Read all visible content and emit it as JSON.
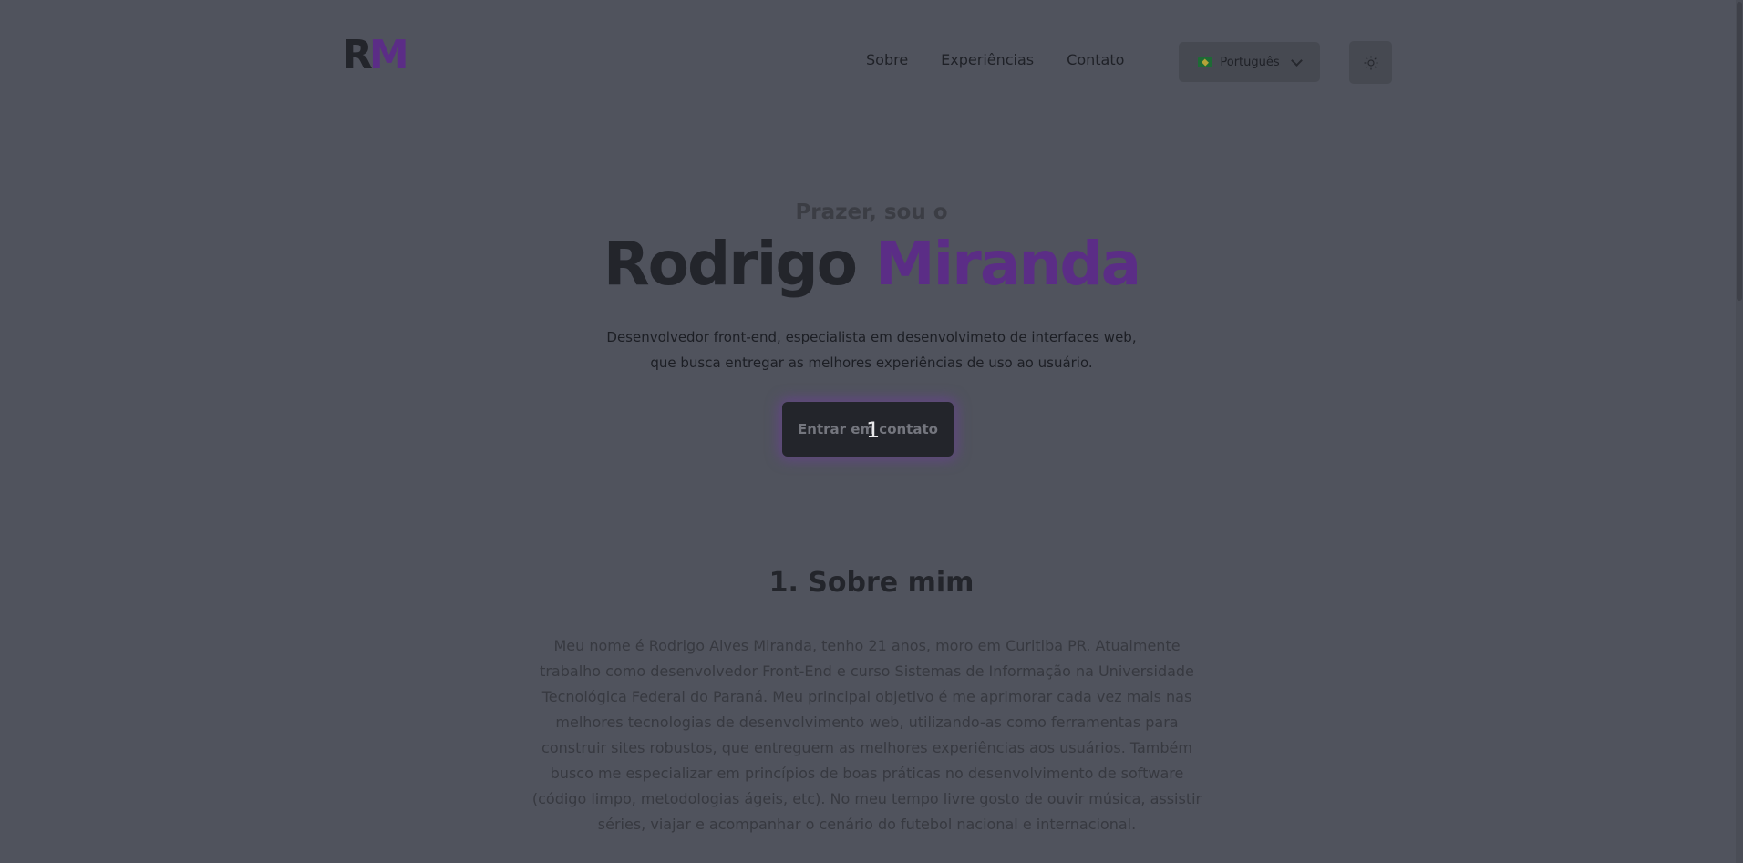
{
  "header": {
    "logo": {
      "r": "R",
      "m": "M"
    },
    "nav": [
      "Sobre",
      "Experiências",
      "Contato"
    ],
    "language": {
      "label": "Português",
      "flag": "brazil-flag-icon"
    },
    "theme_toggle": "sun-icon"
  },
  "hero": {
    "greeting": "Prazer, sou o",
    "first_name": "Rodrigo",
    "last_name": "Miranda",
    "tagline_line1": "Desenvolvedor front-end, especialista em desenvolvimeto de interfaces web,",
    "tagline_line2": "que busca entregar as melhores experiências de uso ao usuário.",
    "cta_label": "Entrar em contato",
    "badge": "1"
  },
  "about": {
    "title": "1. Sobre mim",
    "lines": [
      "Meu nome é Rodrigo Alves Miranda, tenho 21 anos, moro em Curitiba PR. Atualmente",
      "trabalho como desenvolvedor Front-End e curso Sistemas de Informação na Universidade",
      "Tecnológica Federal do Paraná. Meu principal objetivo é me aprimorar cada vez mais nas",
      "melhores tecnologias de desenvolvimento web, utilizando-as como ferramentas para",
      "construir sites robustos, que entreguem as melhores experiências aos usuários. Também",
      "busco me especializar em princípios de boas práticas no desenvolvimento de software",
      "(código limpo, metodologias ágeis, etc). No meu tempo livre gosto de ouvir música, assistir",
      "séries, viajar e acompanhar o cenário do futebol nacional e internacional."
    ]
  },
  "colors": {
    "overlay_bg": "#50535d",
    "text_dark": "#23252b",
    "accent_purple": "#5b2d86",
    "cta_glow": "#6f3ca0"
  }
}
